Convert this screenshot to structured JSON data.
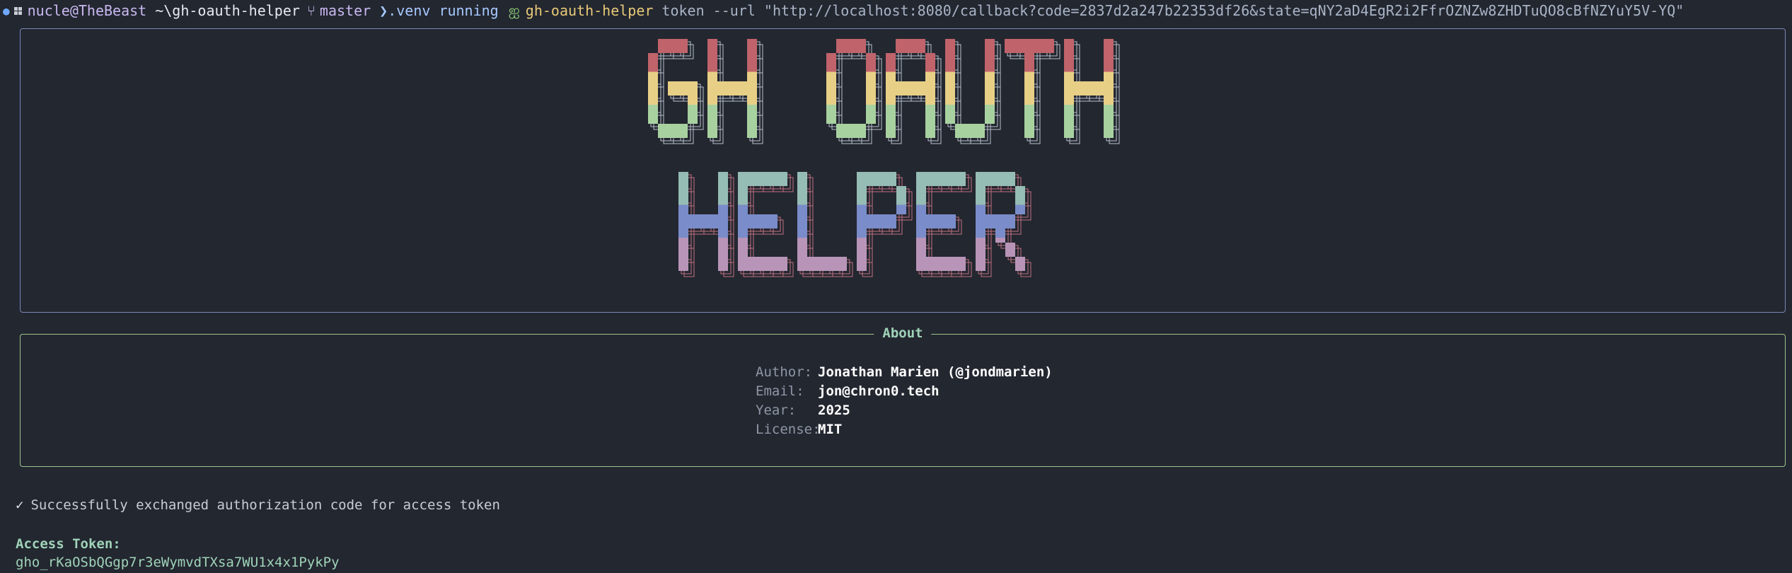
{
  "prompt": {
    "user_host": "nucle@TheBeast",
    "path": "~\\gh-oauth-helper",
    "branch_icon": "git-branch-icon",
    "branch": "master",
    "venv_icon": "chevron-right-icon",
    "venv": ".venv",
    "venv_status": "running",
    "command_icon": "python-icon",
    "command": "gh-oauth-helper",
    "args": "token --url \"http://localhost:8080/callback?code=2837d2a247b22353df26&state=qNY2aD4EgR2i2FfrOZNZw8ZHDTuQO8cBfNZYuY5V-YQ\""
  },
  "banner": {
    "line1": "GH OAUTH",
    "line2": "HELPER",
    "colors": {
      "red": "#c0636b",
      "yellow": "#e8cf86",
      "green": "#a8d1a0",
      "teal": "#95bcb5",
      "blue": "#7a8cc9",
      "pink": "#b895b8"
    }
  },
  "about": {
    "title": "About",
    "rows": [
      {
        "key": "Author:",
        "value": "Jonathan Marien (@jondmarien)"
      },
      {
        "key": "Email:",
        "value": "jon@chron0.tech"
      },
      {
        "key": "Year:",
        "value": "2025"
      },
      {
        "key": "License:",
        "value": "MIT"
      }
    ]
  },
  "output": {
    "check_icon": "checkmark-icon",
    "success_message": "Successfully exchanged authorization code for access token",
    "token_label": "Access Token:",
    "token_value": "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"
  }
}
